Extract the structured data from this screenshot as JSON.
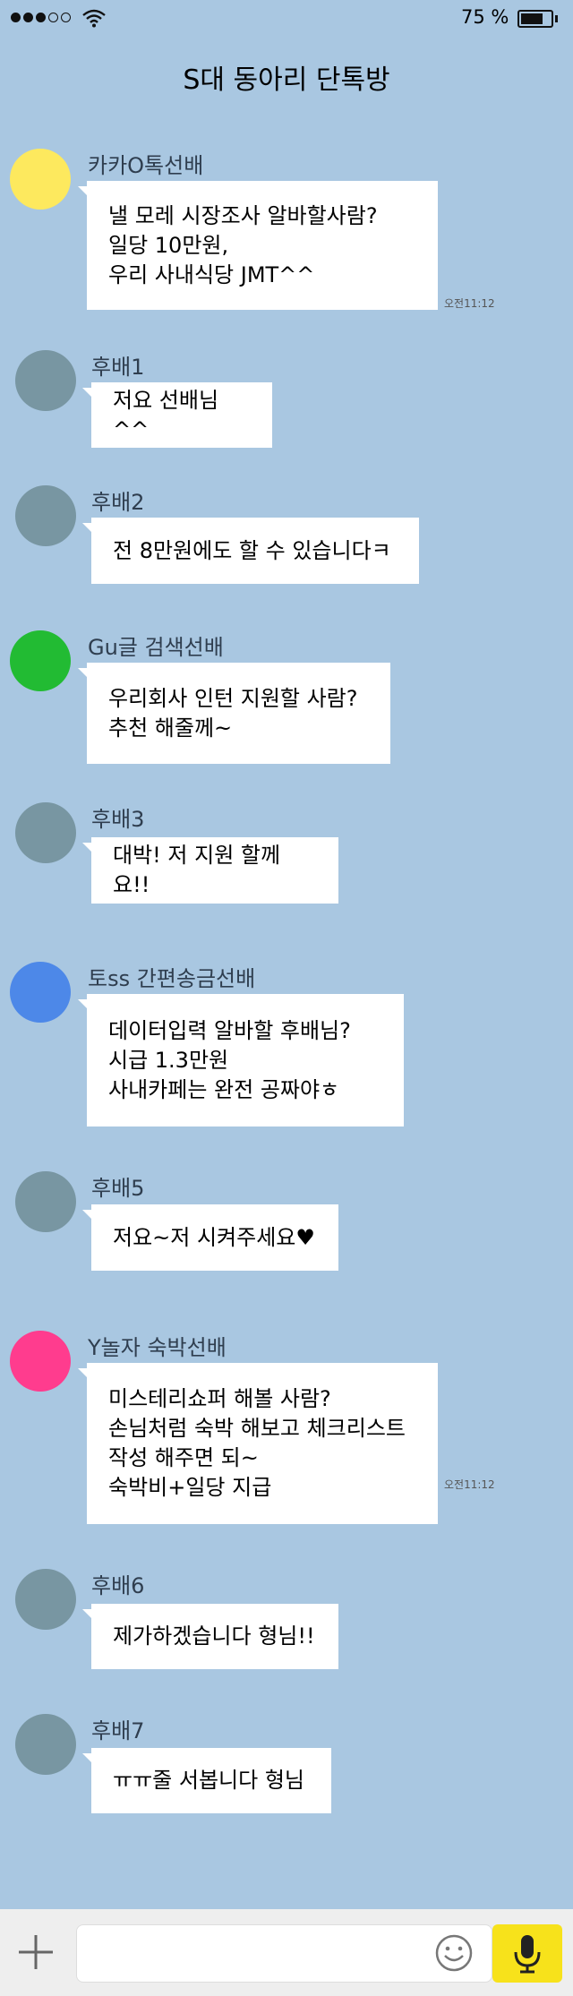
{
  "status_bar": {
    "battery_text": "75 %",
    "battery_level": 0.75,
    "signal_bars": 3,
    "signal_total": 5
  },
  "room": {
    "title": "S대 동아리 단톡방"
  },
  "colors": {
    "background": "#a9c7e1",
    "bubble": "#ffffff",
    "mic_button": "#f7e21b",
    "avatar_junior": "#7896a2"
  },
  "messages": [
    {
      "sender": "카카O톡선배",
      "avatar_color": "#fde95e",
      "text": "낼 모레 시장조사 알바할사람?\n일당 10만원,\n우리 사내식당 JMT^^",
      "time": "오전11:12"
    },
    {
      "sender": "후배1",
      "avatar_color": "#7896a2",
      "text": "저요 선배님^^",
      "time": ""
    },
    {
      "sender": "후배2",
      "avatar_color": "#7896a2",
      "text": "전 8만원에도 할 수 있습니다ㅋ",
      "time": ""
    },
    {
      "sender": "Gu글 검색선배",
      "avatar_color": "#22bb33",
      "text": "우리회사 인턴 지원할 사람?\n추천  해줄께~",
      "time": ""
    },
    {
      "sender": "후배3",
      "avatar_color": "#7896a2",
      "text": "대박! 저 지원 할께요!!",
      "time": ""
    },
    {
      "sender": "토ss 간편송금선배",
      "avatar_color": "#4d88e8",
      "text": "데이터입력 알바할 후배님?\n시급 1.3만원\n사내카페는 완전 공짜야ㅎ",
      "time": ""
    },
    {
      "sender": "후배5",
      "avatar_color": "#7896a2",
      "text": "저요~저 시켜주세요♥",
      "time": ""
    },
    {
      "sender": "Y놀자 숙박선배",
      "avatar_color": "#ff3c8e",
      "text": "미스테리쇼퍼 해볼 사람?\n손님처럼 숙박 해보고 체크리스트\n작성 해주면 되~\n숙박비+일당 지급",
      "time": "오전11:12"
    },
    {
      "sender": "후배6",
      "avatar_color": "#7896a2",
      "text": "제가하겠습니다 형님!!",
      "time": ""
    },
    {
      "sender": "후배7",
      "avatar_color": "#7896a2",
      "text": "ㅠㅠ줄 서봅니다 형님",
      "time": ""
    }
  ],
  "input": {
    "value": "",
    "placeholder": ""
  },
  "icons": {
    "plus": "plus-icon",
    "emoji": "emoji-icon",
    "mic": "microphone-icon",
    "wifi": "wifi-icon",
    "battery": "battery-icon"
  }
}
